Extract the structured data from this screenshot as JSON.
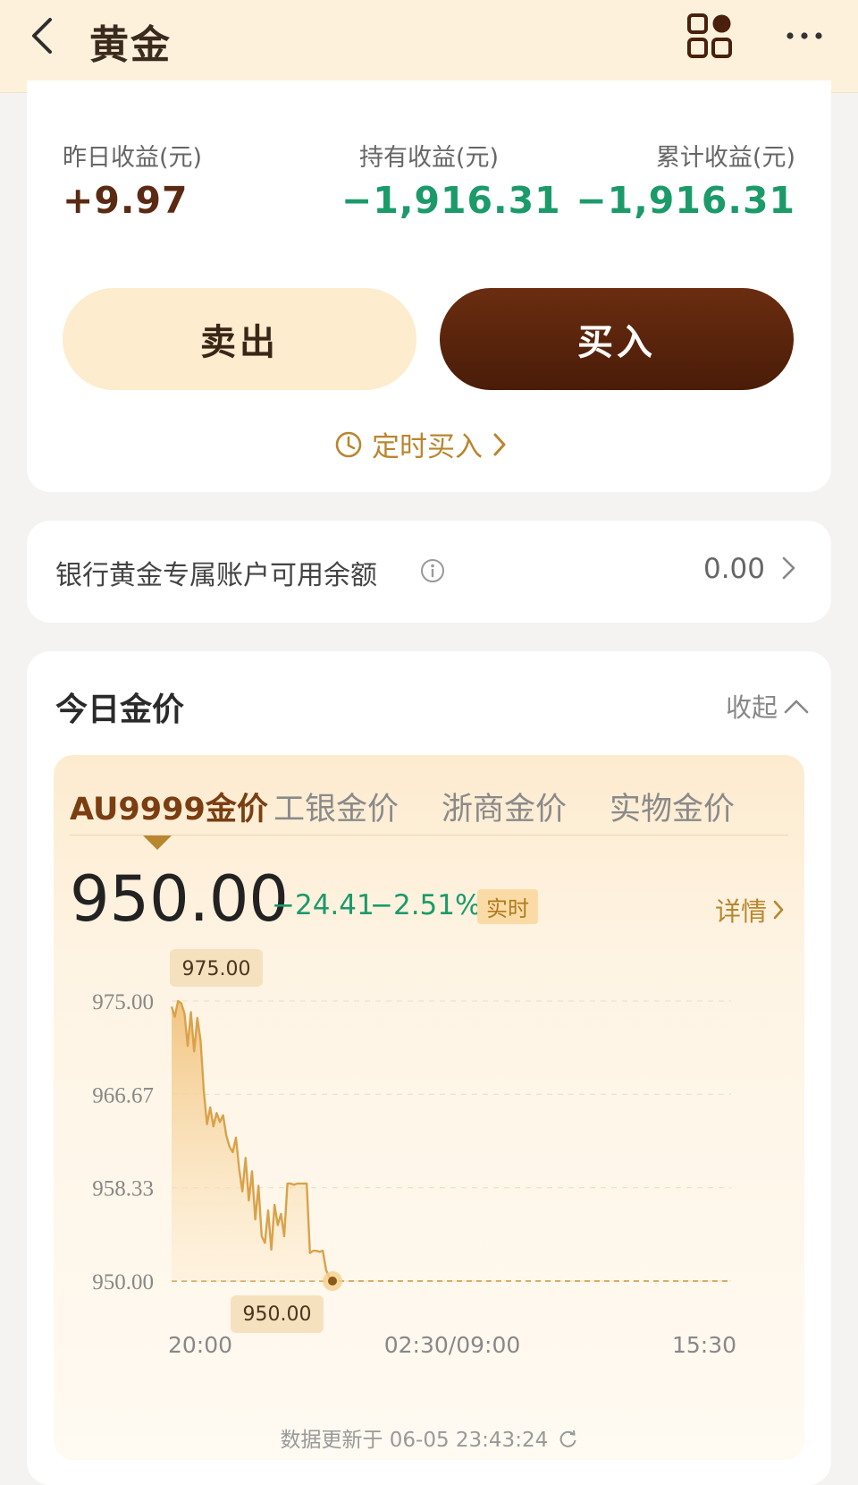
{
  "header": {
    "title": "黄金",
    "apps_icon": "apps-grid-icon",
    "more_icon": "more-dots-icon"
  },
  "earnings": {
    "yesterday": {
      "label": "昨日收益(元)",
      "value": "+9.97"
    },
    "holding": {
      "label": "持有收益(元)",
      "value": "−1,916.31"
    },
    "cumulative": {
      "label": "累计收益(元)",
      "value": "−1,916.31"
    }
  },
  "actions": {
    "sell": "卖出",
    "buy": "买入",
    "schedule": "定时买入"
  },
  "balance": {
    "label": "银行黄金专属账户可用余额",
    "value": "0.00"
  },
  "gold_price": {
    "title": "今日金价",
    "collapse": "收起",
    "tabs": [
      "AU9999金价",
      "工银金价",
      "浙商金价",
      "实物金价"
    ],
    "price": "950.00",
    "change": "−24.41",
    "change_pct": "−2.51%",
    "realtime": "实时",
    "detail": "详情",
    "updated": "数据更新于 06-05 23:43:24"
  },
  "chart_data": {
    "type": "area",
    "ylim": [
      950.0,
      975.0
    ],
    "yticks": [
      "975.00",
      "966.67",
      "958.33",
      "950.00"
    ],
    "xticks": [
      "20:00",
      "02:30/09:00",
      "15:30"
    ],
    "high_label": "975.00",
    "low_label": "950.00",
    "baseline": 950.0,
    "color": "#d9a24a",
    "x": [
      0,
      1,
      2,
      3,
      4,
      5,
      6,
      7,
      8,
      9,
      10,
      11,
      12,
      13,
      14,
      15,
      16,
      17,
      18,
      19,
      20,
      21,
      22,
      23,
      24,
      25,
      26,
      27,
      28,
      29,
      30,
      31,
      32,
      33,
      34,
      35,
      36,
      37,
      38,
      39,
      40,
      41,
      42,
      43,
      44,
      45,
      46,
      47,
      48,
      49,
      50
    ],
    "values": [
      974.5,
      973.6,
      975.0,
      974.8,
      973.9,
      971.0,
      974.0,
      970.5,
      973.5,
      971.5,
      967.0,
      964.0,
      965.5,
      963.8,
      965.0,
      964.2,
      964.8,
      963.0,
      962.0,
      961.5,
      962.8,
      960.0,
      958.0,
      961.0,
      957.2,
      959.8,
      955.5,
      958.5,
      954.0,
      953.4,
      956.3,
      952.8,
      956.8,
      955.0,
      956.0,
      954.0,
      958.7,
      958.7,
      958.6,
      958.7,
      958.7,
      958.7,
      958.7,
      952.5,
      952.7,
      952.7,
      952.6,
      952.7,
      951.0,
      950.3,
      950.0
    ]
  }
}
